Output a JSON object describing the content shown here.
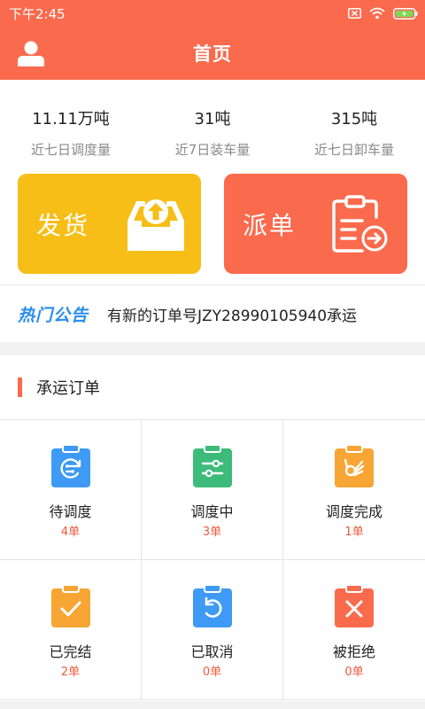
{
  "status_bar": {
    "time": "下午2:45"
  },
  "header": {
    "title": "首页"
  },
  "stats": [
    {
      "value": "11.11万吨",
      "label": "近七日调度量"
    },
    {
      "value": "31吨",
      "label": "近7日装车量"
    },
    {
      "value": "315吨",
      "label": "近七日卸车量"
    }
  ],
  "actions": {
    "ship_label": "发货",
    "dispatch_label": "派单"
  },
  "notice": {
    "tag": "热门公告",
    "text": "有新的订单号JZY28990105940承运"
  },
  "orders": {
    "title": "承运订单",
    "items": [
      {
        "name": "待调度",
        "count": "4单",
        "icon": "clipboard-refresh-icon",
        "color": "#3e9af4"
      },
      {
        "name": "调度中",
        "count": "3单",
        "icon": "clipboard-sliders-icon",
        "color": "#3dbb7a"
      },
      {
        "name": "调度完成",
        "count": "1单",
        "icon": "clipboard-ok-hand-icon",
        "color": "#f7a534"
      },
      {
        "name": "已完结",
        "count": "2单",
        "icon": "clipboard-check-icon",
        "color": "#f7a534"
      },
      {
        "name": "已取消",
        "count": "0单",
        "icon": "clipboard-undo-icon",
        "color": "#3e9af4"
      },
      {
        "name": "被拒绝",
        "count": "0单",
        "icon": "clipboard-x-icon",
        "color": "#fa6a4d"
      }
    ]
  },
  "colors": {
    "brand": "#fa6a4d",
    "ship": "#f6be17",
    "notice_tag": "#2a8ef0",
    "count_text": "#f05a3d"
  }
}
